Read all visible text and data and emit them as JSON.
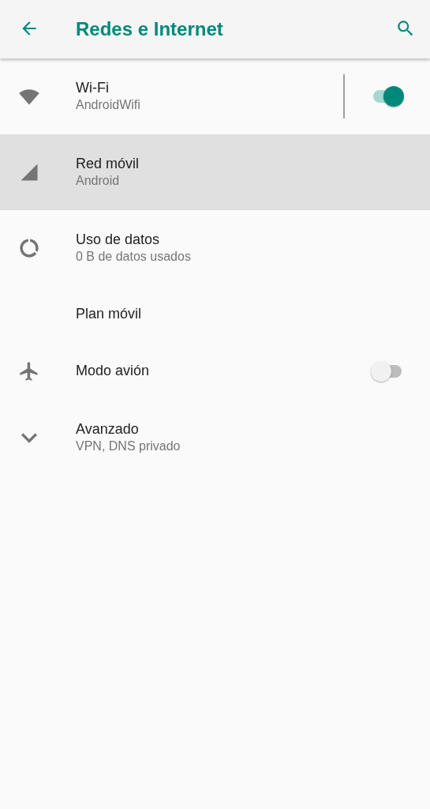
{
  "app_bar": {
    "title": "Redes e Internet"
  },
  "items": [
    {
      "kind": "master_switch",
      "title": "Wi-Fi",
      "subtitle": "AndroidWifi",
      "selected": false,
      "on": true
    },
    {
      "kind": "plain",
      "title": "Red móvil",
      "subtitle": "Android",
      "selected": true
    },
    {
      "kind": "plain",
      "title": "Uso de datos",
      "subtitle": "0 B de datos usados",
      "selected": false
    },
    {
      "kind": "plain",
      "title": "Plan móvil",
      "selected": false
    },
    {
      "kind": "switch",
      "title": "Modo avión",
      "selected": false,
      "on": false
    },
    {
      "kind": "expand",
      "title": "Avanzado",
      "subtitle": "VPN, DNS privado",
      "selected": false
    }
  ]
}
